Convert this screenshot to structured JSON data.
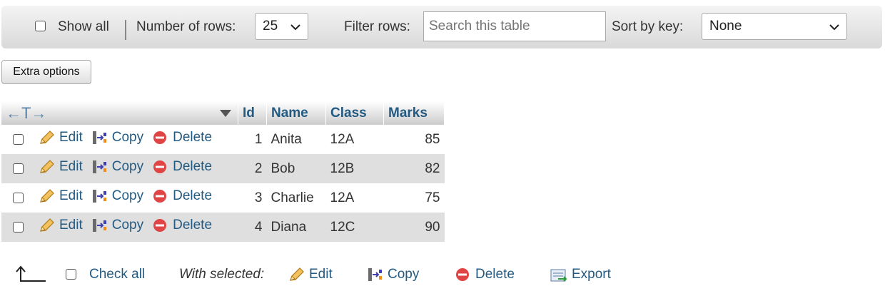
{
  "topbar": {
    "show_all_label": "Show all",
    "rows_label": "Number of rows:",
    "rows_value": "25",
    "filter_label": "Filter rows:",
    "filter_placeholder": "Search this table",
    "sort_label": "Sort by key:",
    "sort_value": "None"
  },
  "extra_options_label": "Extra options",
  "table": {
    "toolbar_arrows": "←T→",
    "columns": [
      "Id",
      "Name",
      "Class",
      "Marks"
    ],
    "action_labels": {
      "edit": "Edit",
      "copy": "Copy",
      "delete": "Delete"
    },
    "rows": [
      {
        "id": "1",
        "name": "Anita",
        "class": "12A",
        "marks": "85"
      },
      {
        "id": "2",
        "name": "Bob",
        "class": "12B",
        "marks": "82"
      },
      {
        "id": "3",
        "name": "Charlie",
        "class": "12A",
        "marks": "75"
      },
      {
        "id": "4",
        "name": "Diana",
        "class": "12C",
        "marks": "90"
      }
    ]
  },
  "bottom": {
    "check_all_label": "Check all",
    "with_selected_label": "With selected:",
    "edit_label": "Edit",
    "copy_label": "Copy",
    "delete_label": "Delete",
    "export_label": "Export"
  },
  "colors": {
    "link": "#235a81",
    "header_gradient_top": "#ffffff",
    "header_gradient_bottom": "#cccccc",
    "row_alt": "#dfdfdf",
    "delete_red": "#e04545"
  }
}
